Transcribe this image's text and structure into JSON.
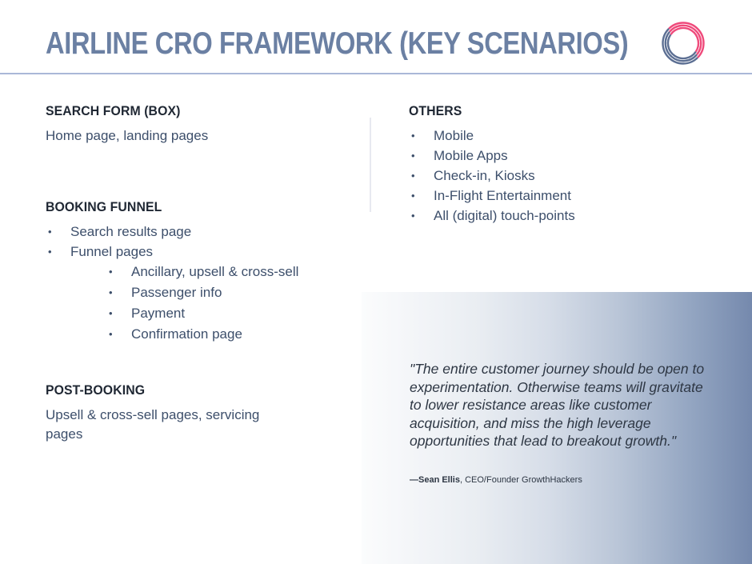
{
  "header": {
    "title": "AIRLINE CRO FRAMEWORK (KEY SCENARIOS)",
    "logo_icon": "concentric-ring-logo-icon",
    "rule_color": "#aab8d8",
    "title_color": "#6b80a3"
  },
  "left_column": {
    "sections": [
      {
        "heading": "SEARCH FORM (BOX)",
        "body": "Home page, landing pages"
      },
      {
        "heading": "BOOKING FUNNEL",
        "bullets": [
          "Search results page",
          "Funnel pages"
        ],
        "sub_bullets": [
          "Ancillary, upsell & cross-sell",
          "Passenger info",
          "Payment",
          "Confirmation page"
        ]
      },
      {
        "heading": "POST-BOOKING",
        "body": "Upsell & cross-sell pages, servicing pages"
      }
    ]
  },
  "right_column": {
    "heading": "OTHERS",
    "bullets": [
      "Mobile",
      "Mobile Apps",
      "Check-in, Kiosks",
      "In-Flight Entertainment",
      "All (digital) touch-points"
    ]
  },
  "quote_panel": {
    "quote": "\"The entire customer journey should be open to experimentation. Otherwise teams will gravitate to lower resistance areas like customer acquisition, and miss the high leverage opportunities that lead to breakout growth.\"",
    "attribution_dash_name": "—Sean Ellis",
    "attribution_role": ", CEO/Founder GrowthHackers",
    "gradient_start": "#fbfcfd",
    "gradient_end": "#7589ad"
  },
  "bullet_glyph": "•",
  "colors": {
    "heading": "#1f2733",
    "body": "#3d4f6b",
    "title": "#6b80a3",
    "logo_pink": "#ef4a7b",
    "logo_blue": "#5c6f93"
  }
}
